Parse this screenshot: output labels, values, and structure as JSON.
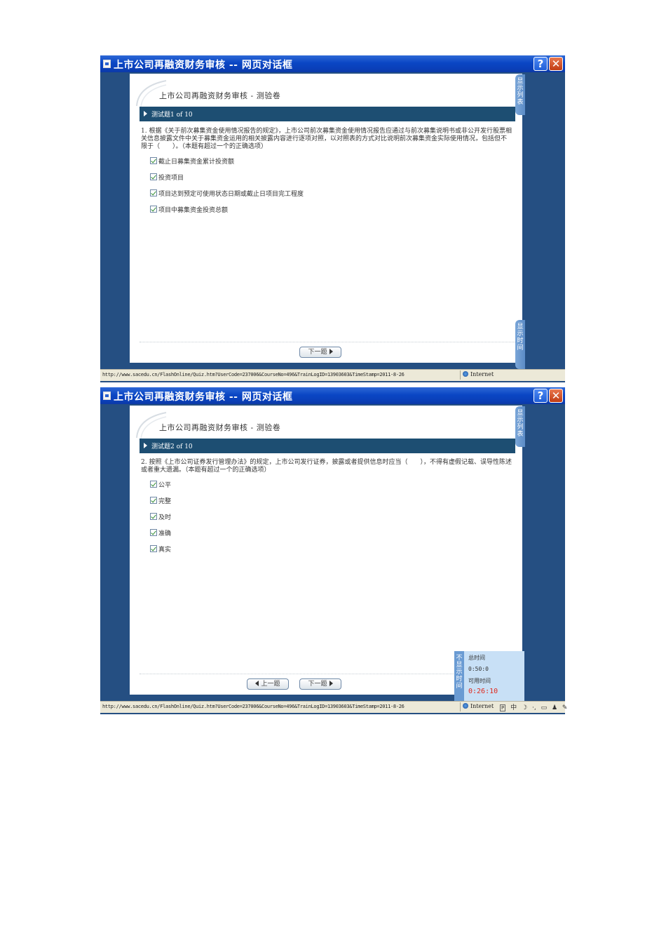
{
  "windows": [
    {
      "title": "上市公司再融资财务审核 -- 网页对话框",
      "doc_title": "上市公司再融资财务审核 - 测验卷",
      "question_header": "测试题1 of 10",
      "question": "1. 根据《关于前次募集资金使用情况报告的规定》，上市公司前次募集资金使用情况报告应通过与前次募集说明书或非公开发行股票相关信息披露文件中关于募集资金运用的相关披露内容进行逐项对照，以对照表的方式对比说明前次募集资金实际使用情况，包括但不限于（　　）。（本题有超过一个的正确选项）",
      "options": [
        "截止日募集资金累计投资额",
        "投资项目",
        "项目达到预定可使用状态日期或截止日项目完工程度",
        "项目中募集资金投资总额"
      ],
      "next_label": "下一题",
      "side_tab_list": "显示列表",
      "side_tab_time": "显示时间",
      "status_url": "http://www.sacedu.cn/FlashOnline/Quiz.htm?UserCode=237006&CourseNo=496&TrainLogID=13903603&TimeStamp=2011-8-26",
      "status_zone": "Internet"
    },
    {
      "title": "上市公司再融资财务审核 -- 网页对话框",
      "doc_title": "上市公司再融资财务审核 - 测验卷",
      "question_header": "测试题2 of 10",
      "question": "2. 按照《上市公司证券发行管理办法》的规定，上市公司发行证券，披露或者提供信息时应当（　　），不得有虚假记载、误导性陈述或者重大遗漏。（本题有超过一个的正确选项）",
      "options": [
        "公平",
        "完整",
        "及时",
        "准确",
        "真实"
      ],
      "prev_label": "上一题",
      "next_label": "下一题",
      "side_tab_list": "显示列表",
      "timer": {
        "tab_label": "不显示时间",
        "total_label": "总时间",
        "total_value": "0:50:0",
        "available_label": "可用时间",
        "available_value": "0:26:10"
      },
      "status_url": "http://www.sacedu.cn/FlashOnline/Quiz.htm?UserCode=237006&CourseNo=496&TrainLogID=13903603&TimeStamp=2011-8-26",
      "status_zone": "Internet",
      "tray": [
        "中"
      ]
    }
  ],
  "colors": {
    "window_bg": "#254f82",
    "title_bar": "#0a46c4",
    "question_bar": "#1d4e72",
    "timer_red": "#e0291c"
  }
}
